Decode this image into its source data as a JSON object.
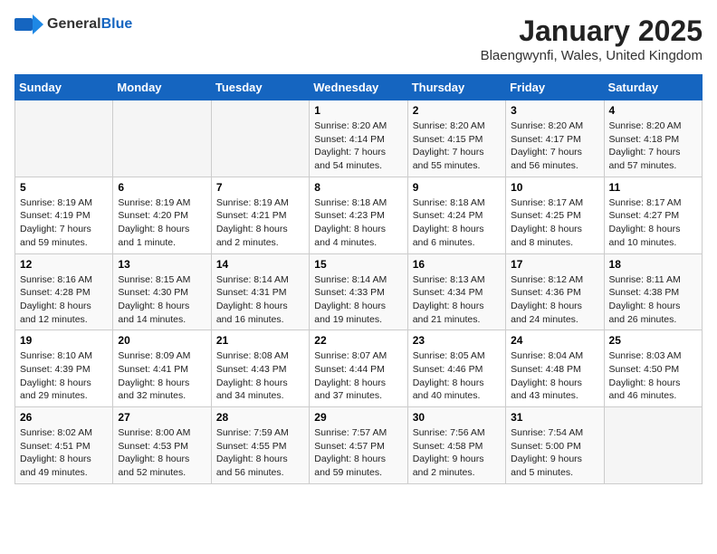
{
  "logo": {
    "general": "General",
    "blue": "Blue"
  },
  "title": "January 2025",
  "location": "Blaengwynfi, Wales, United Kingdom",
  "days_of_week": [
    "Sunday",
    "Monday",
    "Tuesday",
    "Wednesday",
    "Thursday",
    "Friday",
    "Saturday"
  ],
  "weeks": [
    [
      {
        "day": "",
        "info": ""
      },
      {
        "day": "",
        "info": ""
      },
      {
        "day": "",
        "info": ""
      },
      {
        "day": "1",
        "info": "Sunrise: 8:20 AM\nSunset: 4:14 PM\nDaylight: 7 hours\nand 54 minutes."
      },
      {
        "day": "2",
        "info": "Sunrise: 8:20 AM\nSunset: 4:15 PM\nDaylight: 7 hours\nand 55 minutes."
      },
      {
        "day": "3",
        "info": "Sunrise: 8:20 AM\nSunset: 4:17 PM\nDaylight: 7 hours\nand 56 minutes."
      },
      {
        "day": "4",
        "info": "Sunrise: 8:20 AM\nSunset: 4:18 PM\nDaylight: 7 hours\nand 57 minutes."
      }
    ],
    [
      {
        "day": "5",
        "info": "Sunrise: 8:19 AM\nSunset: 4:19 PM\nDaylight: 7 hours\nand 59 minutes."
      },
      {
        "day": "6",
        "info": "Sunrise: 8:19 AM\nSunset: 4:20 PM\nDaylight: 8 hours\nand 1 minute."
      },
      {
        "day": "7",
        "info": "Sunrise: 8:19 AM\nSunset: 4:21 PM\nDaylight: 8 hours\nand 2 minutes."
      },
      {
        "day": "8",
        "info": "Sunrise: 8:18 AM\nSunset: 4:23 PM\nDaylight: 8 hours\nand 4 minutes."
      },
      {
        "day": "9",
        "info": "Sunrise: 8:18 AM\nSunset: 4:24 PM\nDaylight: 8 hours\nand 6 minutes."
      },
      {
        "day": "10",
        "info": "Sunrise: 8:17 AM\nSunset: 4:25 PM\nDaylight: 8 hours\nand 8 minutes."
      },
      {
        "day": "11",
        "info": "Sunrise: 8:17 AM\nSunset: 4:27 PM\nDaylight: 8 hours\nand 10 minutes."
      }
    ],
    [
      {
        "day": "12",
        "info": "Sunrise: 8:16 AM\nSunset: 4:28 PM\nDaylight: 8 hours\nand 12 minutes."
      },
      {
        "day": "13",
        "info": "Sunrise: 8:15 AM\nSunset: 4:30 PM\nDaylight: 8 hours\nand 14 minutes."
      },
      {
        "day": "14",
        "info": "Sunrise: 8:14 AM\nSunset: 4:31 PM\nDaylight: 8 hours\nand 16 minutes."
      },
      {
        "day": "15",
        "info": "Sunrise: 8:14 AM\nSunset: 4:33 PM\nDaylight: 8 hours\nand 19 minutes."
      },
      {
        "day": "16",
        "info": "Sunrise: 8:13 AM\nSunset: 4:34 PM\nDaylight: 8 hours\nand 21 minutes."
      },
      {
        "day": "17",
        "info": "Sunrise: 8:12 AM\nSunset: 4:36 PM\nDaylight: 8 hours\nand 24 minutes."
      },
      {
        "day": "18",
        "info": "Sunrise: 8:11 AM\nSunset: 4:38 PM\nDaylight: 8 hours\nand 26 minutes."
      }
    ],
    [
      {
        "day": "19",
        "info": "Sunrise: 8:10 AM\nSunset: 4:39 PM\nDaylight: 8 hours\nand 29 minutes."
      },
      {
        "day": "20",
        "info": "Sunrise: 8:09 AM\nSunset: 4:41 PM\nDaylight: 8 hours\nand 32 minutes."
      },
      {
        "day": "21",
        "info": "Sunrise: 8:08 AM\nSunset: 4:43 PM\nDaylight: 8 hours\nand 34 minutes."
      },
      {
        "day": "22",
        "info": "Sunrise: 8:07 AM\nSunset: 4:44 PM\nDaylight: 8 hours\nand 37 minutes."
      },
      {
        "day": "23",
        "info": "Sunrise: 8:05 AM\nSunset: 4:46 PM\nDaylight: 8 hours\nand 40 minutes."
      },
      {
        "day": "24",
        "info": "Sunrise: 8:04 AM\nSunset: 4:48 PM\nDaylight: 8 hours\nand 43 minutes."
      },
      {
        "day": "25",
        "info": "Sunrise: 8:03 AM\nSunset: 4:50 PM\nDaylight: 8 hours\nand 46 minutes."
      }
    ],
    [
      {
        "day": "26",
        "info": "Sunrise: 8:02 AM\nSunset: 4:51 PM\nDaylight: 8 hours\nand 49 minutes."
      },
      {
        "day": "27",
        "info": "Sunrise: 8:00 AM\nSunset: 4:53 PM\nDaylight: 8 hours\nand 52 minutes."
      },
      {
        "day": "28",
        "info": "Sunrise: 7:59 AM\nSunset: 4:55 PM\nDaylight: 8 hours\nand 56 minutes."
      },
      {
        "day": "29",
        "info": "Sunrise: 7:57 AM\nSunset: 4:57 PM\nDaylight: 8 hours\nand 59 minutes."
      },
      {
        "day": "30",
        "info": "Sunrise: 7:56 AM\nSunset: 4:58 PM\nDaylight: 9 hours\nand 2 minutes."
      },
      {
        "day": "31",
        "info": "Sunrise: 7:54 AM\nSunset: 5:00 PM\nDaylight: 9 hours\nand 5 minutes."
      },
      {
        "day": "",
        "info": ""
      }
    ]
  ]
}
